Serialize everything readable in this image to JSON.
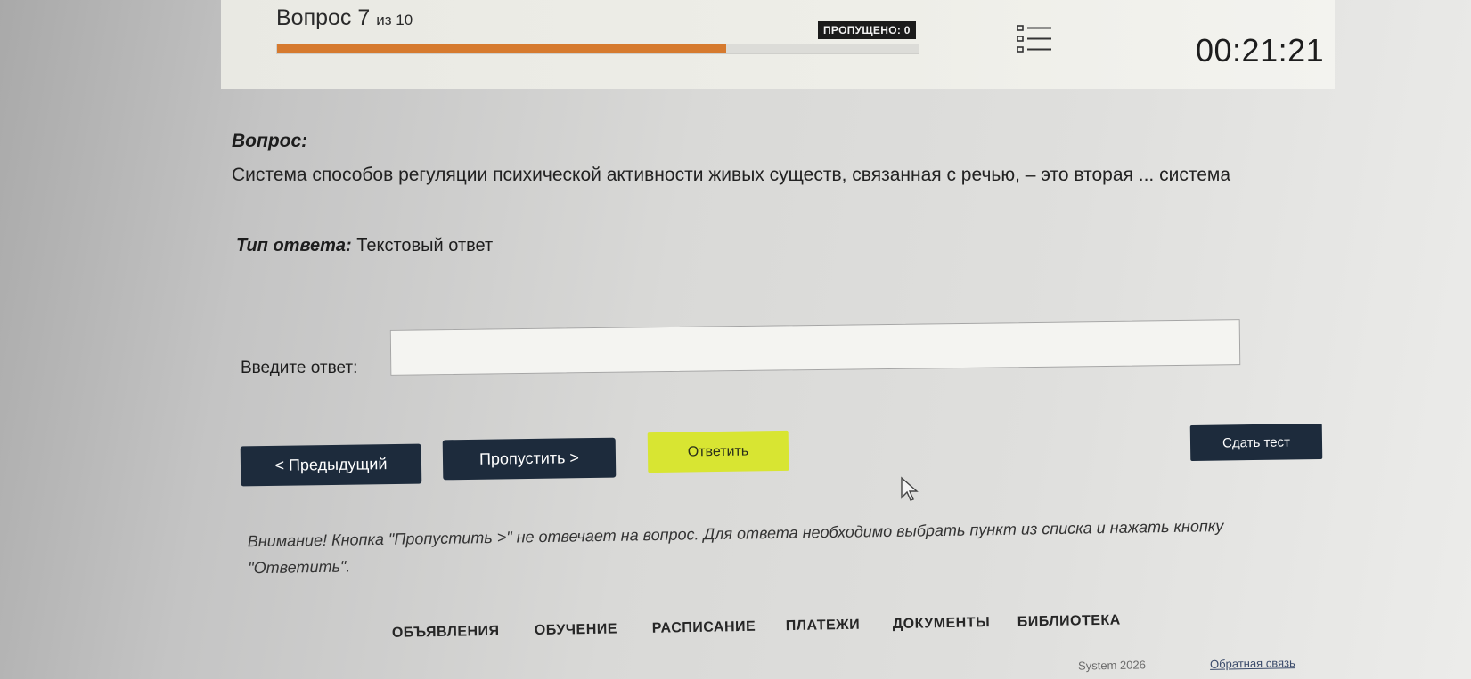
{
  "header": {
    "question_word": "Вопрос 7",
    "question_of": "из 10",
    "progress_fraction": 0.7,
    "skipped_label": "ПРОПУЩЕНО: 0",
    "list_icon": "question-list-icon",
    "timer": "00:21:21"
  },
  "question": {
    "label": "Вопрос:",
    "text": "Система способов регуляции психической активности живых существ, связанная с речью, – это вторая ... система"
  },
  "answer_type": {
    "label": "Тип ответа:",
    "value": "Текстовый ответ"
  },
  "answer": {
    "label": "Введите ответ:",
    "value": "",
    "placeholder": ""
  },
  "buttons": {
    "prev": "< Предыдущий",
    "skip": "Пропустить >",
    "answer": "Ответить",
    "finish": "Сдать тест"
  },
  "colors": {
    "progress": "#d67a2e",
    "answer_button": "#d8e532",
    "primary_button": "#1d2b3c"
  },
  "warning": "Внимание! Кнопка \"Пропустить >\" не отвечает на вопрос. Для ответа необходимо выбрать пункт из списка и нажать кнопку \"Ответить\".",
  "footer": {
    "nav": [
      "ОБЪЯВЛЕНИЯ",
      "ОБУЧЕНИЕ",
      "РАСПИСАНИЕ",
      "ПЛАТЕЖИ",
      "ДОКУМЕНТЫ",
      "БИБЛИОТЕКА"
    ],
    "copyright": "System 2026",
    "feedback": "Обратная связь"
  }
}
